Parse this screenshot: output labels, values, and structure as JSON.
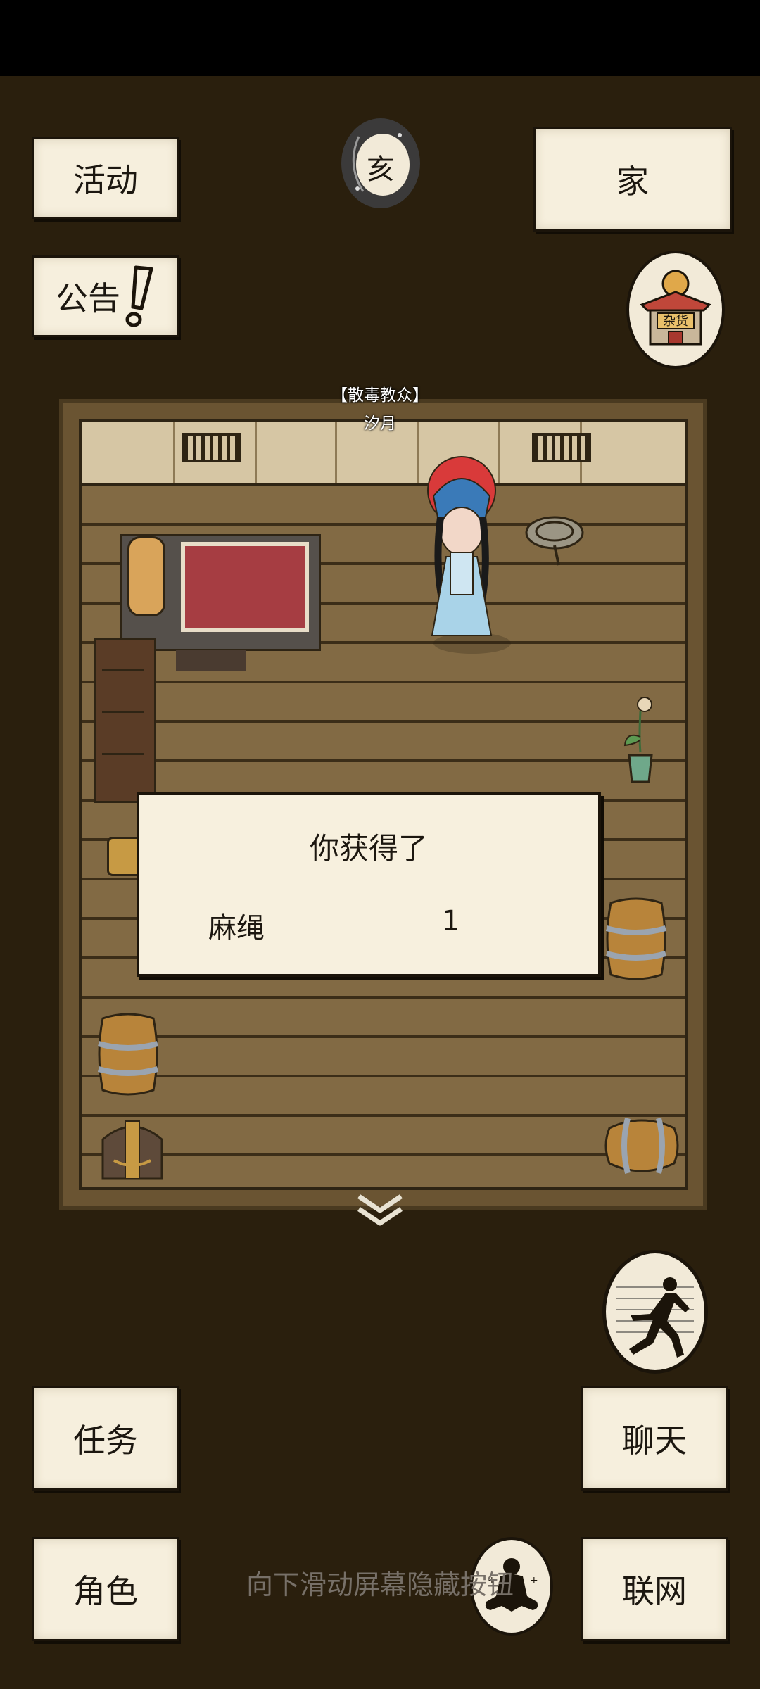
{
  "top_left": {
    "events_label": "活动",
    "notice_label": "公告"
  },
  "top_center": {
    "time_glyph": "亥"
  },
  "top_right": {
    "home_label": "家",
    "shop_sign": "杂货"
  },
  "character": {
    "title": "【散毒教众】",
    "name": "汐月"
  },
  "reward_dialog": {
    "title": "你获得了",
    "item_name": "麻绳",
    "item_qty": "1"
  },
  "bottom": {
    "quest_label": "任务",
    "chat_label": "聊天",
    "role_label": "角色",
    "online_label": "联网"
  },
  "hint": "向下滑动屏幕隐藏按钮",
  "icons": {
    "moon_badge": "moon-time-icon",
    "shop": "general-store-icon",
    "run": "run-icon",
    "meditate": "meditate-icon",
    "alert": "exclamation-icon",
    "collapse": "double-chevron-down-icon"
  },
  "colors": {
    "background": "#2a1f0d",
    "paper": "#f6efdd",
    "ink": "#1c1710"
  }
}
